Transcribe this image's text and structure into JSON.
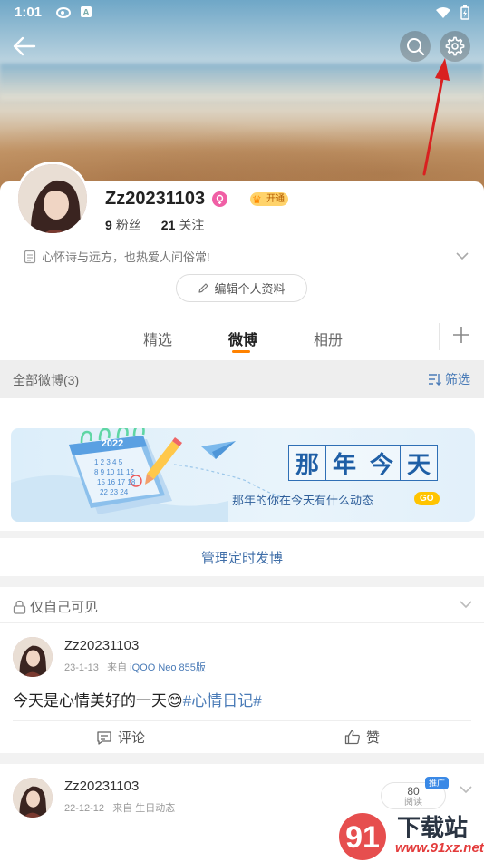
{
  "status_bar": {
    "time": "1:01",
    "app_icon_1": "weibo-icon",
    "app_icon_2": "a-icon"
  },
  "header": {
    "back_icon": "back-arrow-icon",
    "search_icon": "search-icon",
    "settings_icon": "gear-icon"
  },
  "profile": {
    "username": "Zz20231103",
    "vip_label": "开通",
    "followers_count": "9",
    "followers_label": "粉丝",
    "following_count": "21",
    "following_label": "关注",
    "bio": "心怀诗与远方，也热爱人间俗常!",
    "edit_button": "编辑个人资料"
  },
  "tabs": [
    {
      "label": "精选",
      "active": false
    },
    {
      "label": "微博",
      "active": true
    },
    {
      "label": "相册",
      "active": false
    }
  ],
  "filter": {
    "all_posts": "全部微博(3)",
    "filter_label": "筛选"
  },
  "banner": {
    "calendar_year": "2022",
    "title_chars": [
      "那",
      "年",
      "今",
      "天"
    ],
    "subtitle": "那年的你在今天有什么动态",
    "go_label": "GO"
  },
  "scheduled": {
    "label": "管理定时发博"
  },
  "post1": {
    "visibility": "仅自己可见",
    "username": "Zz20231103",
    "date": "23-1-13",
    "from_prefix": "来自",
    "source": "iQOO Neo 855版",
    "text_main": "今天是心情美好的一天😊",
    "hashtag": "#心情日记#",
    "comment_label": "评论",
    "like_label": "赞"
  },
  "post2": {
    "username": "Zz20231103",
    "date": "22-12-12",
    "from_prefix": "来自",
    "source": "生日动态",
    "reads_count": "80",
    "reads_label": "阅读",
    "promo_label": "推广"
  },
  "watermark": {
    "text": "下载站",
    "url": "www.91xz.net"
  },
  "colors": {
    "accent": "#ff8200",
    "link": "#4a7bb7",
    "annotation_arrow": "#d92020"
  }
}
